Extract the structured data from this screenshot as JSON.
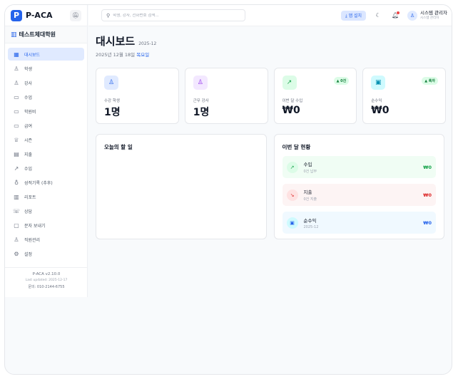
{
  "app": {
    "logo_letter": "P",
    "name": "P-ACA"
  },
  "academy": {
    "name": "테스트체대학원"
  },
  "sidebar": {
    "items": [
      {
        "label": "대시보드",
        "icon": "grid-icon",
        "glyph": "▦",
        "active": true
      },
      {
        "label": "학생",
        "icon": "users-icon",
        "glyph": "♙",
        "active": false
      },
      {
        "label": "강사",
        "icon": "user-check-icon",
        "glyph": "♙",
        "active": false
      },
      {
        "label": "수업",
        "icon": "calendar-icon",
        "glyph": "▭",
        "active": false
      },
      {
        "label": "학원비",
        "icon": "credit-card-icon",
        "glyph": "▭",
        "active": false
      },
      {
        "label": "급여",
        "icon": "wallet-icon",
        "glyph": "▭",
        "active": false
      },
      {
        "label": "시즌",
        "icon": "trophy-icon",
        "glyph": "♕",
        "active": false
      },
      {
        "label": "지출",
        "icon": "receipt-icon",
        "glyph": "▤",
        "active": false
      },
      {
        "label": "수입",
        "icon": "trending-up-icon",
        "glyph": "↗",
        "active": false
      },
      {
        "label": "성적기록 (추후)",
        "icon": "award-icon",
        "glyph": "♁",
        "active": false
      },
      {
        "label": "리포트",
        "icon": "bar-chart-icon",
        "glyph": "▥",
        "active": false
      },
      {
        "label": "상담",
        "icon": "phone-icon",
        "glyph": "☏",
        "active": false
      },
      {
        "label": "문자 보내기",
        "icon": "message-icon",
        "glyph": "▢",
        "active": false
      },
      {
        "label": "직원관리",
        "icon": "user-cog-icon",
        "glyph": "♙",
        "active": false
      },
      {
        "label": "설정",
        "icon": "settings-icon",
        "glyph": "⚙",
        "active": false
      }
    ],
    "footer": {
      "version": "P-ACA v2.10.0",
      "last_updated": "Last updated: 2025-12-17",
      "inquiry": "문의: 010-2144-6755"
    }
  },
  "topbar": {
    "search_placeholder": "학생, 강사, 전화번호 검색...",
    "install_label": "⤓ 앱 설치",
    "user_name": "시스템 관리자",
    "user_role": "시스템 관리자"
  },
  "dashboard": {
    "title": "대시보드",
    "month": "2025-12",
    "date_main": "2025년 12월 18일 ",
    "weekday": "목요일",
    "cards": [
      {
        "label": "수강 학생",
        "value": "1명",
        "icon": "users-icon",
        "glyph": "♙",
        "icon_bg": "#e0eaff",
        "icon_color": "#2563eb",
        "tag": ""
      },
      {
        "label": "근무 강사",
        "value": "1명",
        "icon": "user-check-icon",
        "glyph": "♙",
        "icon_bg": "#f3e8ff",
        "icon_color": "#9333ea",
        "tag": ""
      },
      {
        "label": "이번 달 수입",
        "value": "₩0",
        "icon": "trending-up-icon",
        "glyph": "↗",
        "icon_bg": "#dcfce7",
        "icon_color": "#16a34a",
        "tag": "▲ 0건"
      },
      {
        "label": "순수익",
        "value": "₩0",
        "icon": "wallet-icon",
        "glyph": "▣",
        "icon_bg": "#cffafe",
        "icon_color": "#0891b2",
        "tag": "▲ 흑자"
      }
    ],
    "todo": {
      "title": "오늘의 할 일"
    },
    "status": {
      "title": "이번 달 현황",
      "items": [
        {
          "name": "수입",
          "sub": "0건 납부",
          "amount": "₩0",
          "icon": "arrow-up-right-icon",
          "glyph": "↗",
          "bg": "#f0fdf4",
          "icon_bg": "#dcfce7",
          "color": "#16a34a"
        },
        {
          "name": "지출",
          "sub": "0건 지출",
          "amount": "₩0",
          "icon": "arrow-down-right-icon",
          "glyph": "↘",
          "bg": "#fdf4f4",
          "icon_bg": "#fee2e2",
          "color": "#dc2626"
        },
        {
          "name": "순수익",
          "sub": "2025-12",
          "amount": "₩0",
          "icon": "wallet-icon",
          "glyph": "▣",
          "bg": "#f0f9ff",
          "icon_bg": "#cffafe",
          "color": "#2563eb"
        }
      ]
    }
  }
}
